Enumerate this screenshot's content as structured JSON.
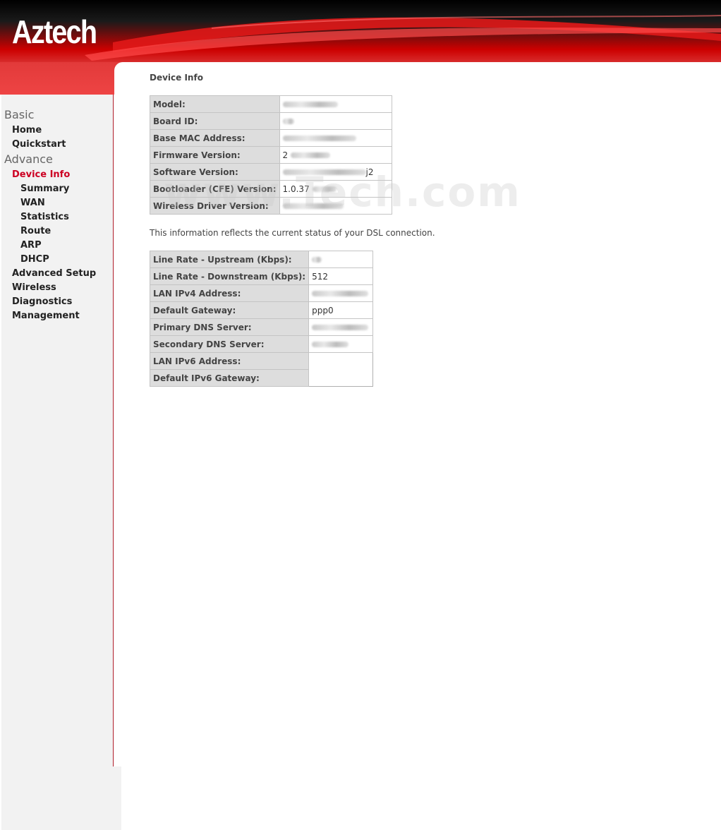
{
  "header": {
    "logo": "Aztech"
  },
  "sidebar": {
    "basic": {
      "label": "Basic",
      "items": [
        {
          "label": "Home"
        },
        {
          "label": "Quickstart"
        }
      ]
    },
    "advance": {
      "label": "Advance",
      "device_info": {
        "label": "Device Info"
      },
      "sub_items": [
        {
          "label": "Summary"
        },
        {
          "label": "WAN"
        },
        {
          "label": "Statistics"
        },
        {
          "label": "Route"
        },
        {
          "label": "ARP"
        },
        {
          "label": "DHCP"
        }
      ],
      "items": [
        {
          "label": "Advanced Setup"
        },
        {
          "label": "Wireless"
        },
        {
          "label": "Diagnostics"
        },
        {
          "label": "Management"
        }
      ]
    }
  },
  "main": {
    "title": "Device Info",
    "device_table": [
      {
        "label": "Model:",
        "value": ""
      },
      {
        "label": "Board ID:",
        "value": ""
      },
      {
        "label": "Base MAC Address:",
        "value": ""
      },
      {
        "label": "Firmware Version:",
        "value": "2"
      },
      {
        "label": "Software Version:",
        "value": "j2"
      },
      {
        "label": "Bootloader (CFE) Version:",
        "value": "1.0.37"
      },
      {
        "label": "Wireless Driver Version:",
        "value": ""
      }
    ],
    "status_note": "This information reflects the current status of your DSL connection.",
    "dsl_table": [
      {
        "label": "Line Rate - Upstream (Kbps):",
        "value": ""
      },
      {
        "label": "Line Rate - Downstream (Kbps):",
        "value": "512"
      },
      {
        "label": "LAN IPv4 Address:",
        "value": ""
      },
      {
        "label": "Default Gateway:",
        "value": "ppp0"
      },
      {
        "label": "Primary DNS Server:",
        "value": ""
      },
      {
        "label": "Secondary DNS Server:",
        "value": ""
      },
      {
        "label": "LAN IPv6 Address:",
        "value": ""
      },
      {
        "label": "Default IPv6 Gateway:",
        "value": ""
      }
    ],
    "watermark": "www.Tech.com"
  }
}
